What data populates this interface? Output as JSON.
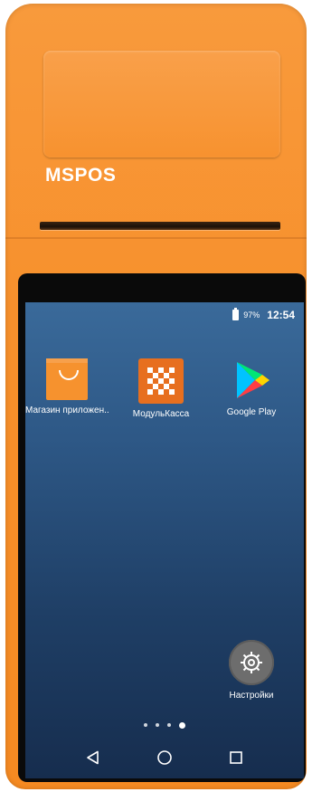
{
  "device": {
    "brand": "MSPOS",
    "body_color": "#f7902c"
  },
  "status_bar": {
    "battery_icon": "battery-icon",
    "battery_percent": "97%",
    "time": "12:54"
  },
  "home_screen": {
    "apps": [
      {
        "label": "Магазин приложен..",
        "icon": "shopping-bag-icon",
        "color": "#f6922e"
      },
      {
        "label": "МодульКасса",
        "icon": "modulkassa-logo-icon",
        "color": "#e76f1f"
      },
      {
        "label": "Google Play",
        "icon": "google-play-icon",
        "color": "#01875f"
      }
    ],
    "dock_apps": [
      {
        "label": "Настройки",
        "icon": "gear-icon",
        "color": "#6d6d6d"
      }
    ],
    "page_indicator": {
      "pages": 4,
      "current_index": 4
    }
  },
  "nav_bar": {
    "buttons": [
      {
        "icon": "back-icon"
      },
      {
        "icon": "home-icon"
      },
      {
        "icon": "recents-icon"
      }
    ]
  }
}
